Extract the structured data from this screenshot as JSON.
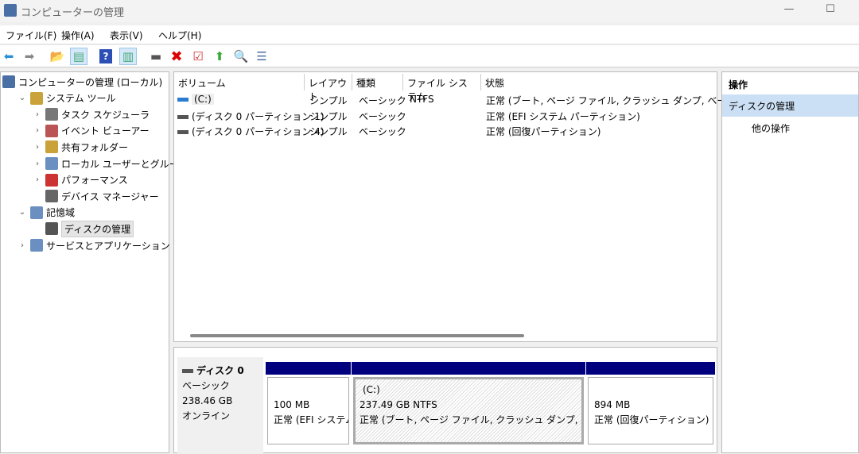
{
  "window": {
    "title": "コンピューターの管理",
    "minimize": "—",
    "maximize": "☐"
  },
  "menu": [
    "ファイル(F)",
    "操作(A)",
    "表示(V)",
    "ヘルプ(H)"
  ],
  "toolbar": [
    "back-icon",
    "forward-icon",
    "up-folder-icon",
    "show-hide-tree-icon",
    "help-icon",
    "show-hide-action-pane-icon",
    "connect-drive-icon",
    "delete-icon",
    "properties-icon",
    "export-icon",
    "search-icon",
    "list-view-icon"
  ],
  "tree": [
    {
      "label": "コンピューターの管理 (ローカル)",
      "level": 0,
      "exp": ""
    },
    {
      "label": "システム ツール",
      "level": 1,
      "exp": "⌄"
    },
    {
      "label": "タスク スケジューラ",
      "level": 2,
      "exp": "›"
    },
    {
      "label": "イベント ビューアー",
      "level": 2,
      "exp": "›"
    },
    {
      "label": "共有フォルダー",
      "level": 2,
      "exp": "›"
    },
    {
      "label": "ローカル ユーザーとグループ",
      "level": 2,
      "exp": "›"
    },
    {
      "label": "パフォーマンス",
      "level": 2,
      "exp": "›"
    },
    {
      "label": "デバイス マネージャー",
      "level": 2,
      "exp": ""
    },
    {
      "label": "記憶域",
      "level": 1,
      "exp": "⌄"
    },
    {
      "label": "ディスクの管理",
      "level": 2,
      "exp": "",
      "selected": true
    },
    {
      "label": "サービスとアプリケーション",
      "level": 1,
      "exp": "›"
    }
  ],
  "volumes": {
    "headers": [
      "ボリューム",
      "レイアウト",
      "種類",
      "ファイル システム",
      "状態"
    ],
    "rows": [
      {
        "volume": "(C:)",
        "layout": "シンプル",
        "type": "ベーシック",
        "fs": "NTFS",
        "status": "正常 (ブート, ページ ファイル, クラッシュ ダンプ, ベーシック デ"
      },
      {
        "volume": "(ディスク 0 パーティション 1)",
        "layout": "シンプル",
        "type": "ベーシック",
        "fs": "",
        "status": "正常 (EFI システム パーティション)"
      },
      {
        "volume": "(ディスク 0 パーティション 4)",
        "layout": "シンプル",
        "type": "ベーシック",
        "fs": "",
        "status": "正常 (回復パーティション)"
      }
    ]
  },
  "disk": {
    "name": "ディスク 0",
    "type": "ベーシック",
    "size": "238.46 GB",
    "state": "オンライン",
    "partitions": [
      {
        "name": "",
        "size": "100 MB",
        "status": "正常 (EFI システム パーティション)"
      },
      {
        "name": "(C:)",
        "size": "237.49 GB NTFS",
        "status": "正常 (ブート, ページ ファイル, クラッシュ ダンプ, ベーシック データ パーティション)"
      },
      {
        "name": "",
        "size": "894 MB",
        "status": "正常 (回復パーティション)"
      }
    ]
  },
  "actions": {
    "header": "操作",
    "selected": "ディスクの管理",
    "more": "他の操作"
  },
  "colors": {
    "partition_bar": "#00007f",
    "selected": "#cce0f5"
  }
}
